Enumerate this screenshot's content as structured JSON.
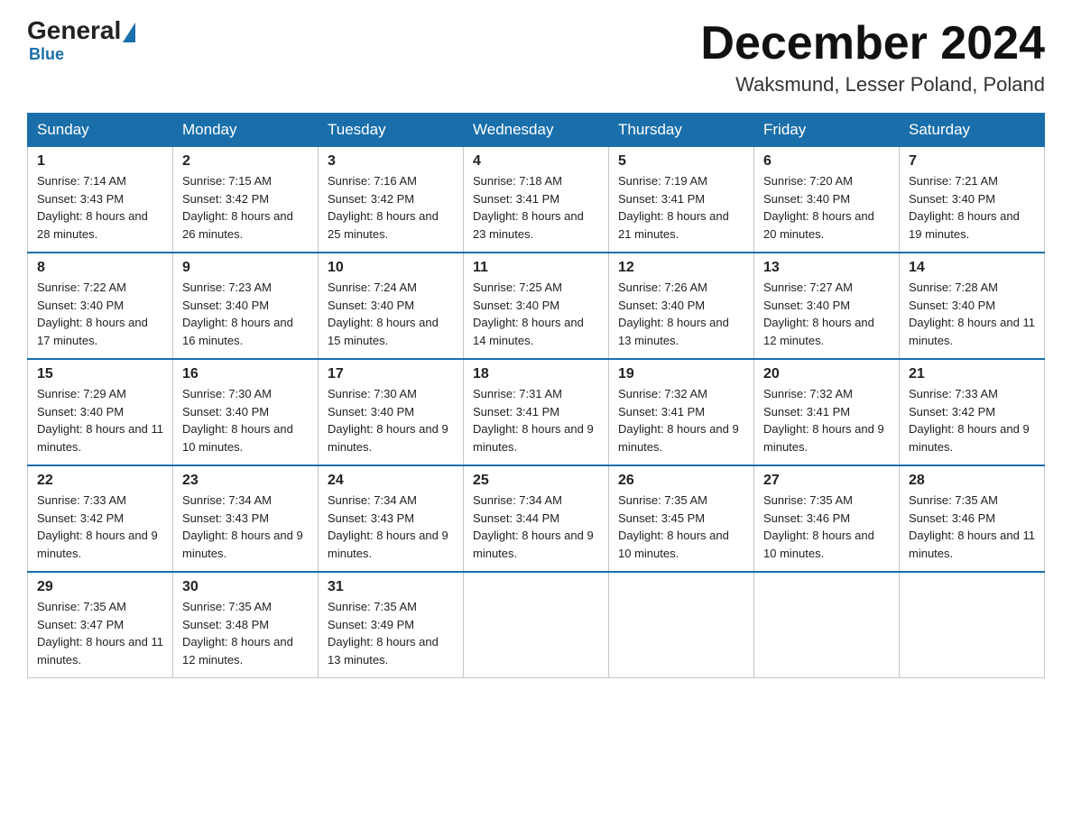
{
  "header": {
    "logo_general": "General",
    "logo_blue": "Blue",
    "month_title": "December 2024",
    "location": "Waksmund, Lesser Poland, Poland"
  },
  "days_of_week": [
    "Sunday",
    "Monday",
    "Tuesday",
    "Wednesday",
    "Thursday",
    "Friday",
    "Saturday"
  ],
  "weeks": [
    [
      {
        "num": "1",
        "sunrise": "7:14 AM",
        "sunset": "3:43 PM",
        "daylight": "8 hours and 28 minutes."
      },
      {
        "num": "2",
        "sunrise": "7:15 AM",
        "sunset": "3:42 PM",
        "daylight": "8 hours and 26 minutes."
      },
      {
        "num": "3",
        "sunrise": "7:16 AM",
        "sunset": "3:42 PM",
        "daylight": "8 hours and 25 minutes."
      },
      {
        "num": "4",
        "sunrise": "7:18 AM",
        "sunset": "3:41 PM",
        "daylight": "8 hours and 23 minutes."
      },
      {
        "num": "5",
        "sunrise": "7:19 AM",
        "sunset": "3:41 PM",
        "daylight": "8 hours and 21 minutes."
      },
      {
        "num": "6",
        "sunrise": "7:20 AM",
        "sunset": "3:40 PM",
        "daylight": "8 hours and 20 minutes."
      },
      {
        "num": "7",
        "sunrise": "7:21 AM",
        "sunset": "3:40 PM",
        "daylight": "8 hours and 19 minutes."
      }
    ],
    [
      {
        "num": "8",
        "sunrise": "7:22 AM",
        "sunset": "3:40 PM",
        "daylight": "8 hours and 17 minutes."
      },
      {
        "num": "9",
        "sunrise": "7:23 AM",
        "sunset": "3:40 PM",
        "daylight": "8 hours and 16 minutes."
      },
      {
        "num": "10",
        "sunrise": "7:24 AM",
        "sunset": "3:40 PM",
        "daylight": "8 hours and 15 minutes."
      },
      {
        "num": "11",
        "sunrise": "7:25 AM",
        "sunset": "3:40 PM",
        "daylight": "8 hours and 14 minutes."
      },
      {
        "num": "12",
        "sunrise": "7:26 AM",
        "sunset": "3:40 PM",
        "daylight": "8 hours and 13 minutes."
      },
      {
        "num": "13",
        "sunrise": "7:27 AM",
        "sunset": "3:40 PM",
        "daylight": "8 hours and 12 minutes."
      },
      {
        "num": "14",
        "sunrise": "7:28 AM",
        "sunset": "3:40 PM",
        "daylight": "8 hours and 11 minutes."
      }
    ],
    [
      {
        "num": "15",
        "sunrise": "7:29 AM",
        "sunset": "3:40 PM",
        "daylight": "8 hours and 11 minutes."
      },
      {
        "num": "16",
        "sunrise": "7:30 AM",
        "sunset": "3:40 PM",
        "daylight": "8 hours and 10 minutes."
      },
      {
        "num": "17",
        "sunrise": "7:30 AM",
        "sunset": "3:40 PM",
        "daylight": "8 hours and 9 minutes."
      },
      {
        "num": "18",
        "sunrise": "7:31 AM",
        "sunset": "3:41 PM",
        "daylight": "8 hours and 9 minutes."
      },
      {
        "num": "19",
        "sunrise": "7:32 AM",
        "sunset": "3:41 PM",
        "daylight": "8 hours and 9 minutes."
      },
      {
        "num": "20",
        "sunrise": "7:32 AM",
        "sunset": "3:41 PM",
        "daylight": "8 hours and 9 minutes."
      },
      {
        "num": "21",
        "sunrise": "7:33 AM",
        "sunset": "3:42 PM",
        "daylight": "8 hours and 9 minutes."
      }
    ],
    [
      {
        "num": "22",
        "sunrise": "7:33 AM",
        "sunset": "3:42 PM",
        "daylight": "8 hours and 9 minutes."
      },
      {
        "num": "23",
        "sunrise": "7:34 AM",
        "sunset": "3:43 PM",
        "daylight": "8 hours and 9 minutes."
      },
      {
        "num": "24",
        "sunrise": "7:34 AM",
        "sunset": "3:43 PM",
        "daylight": "8 hours and 9 minutes."
      },
      {
        "num": "25",
        "sunrise": "7:34 AM",
        "sunset": "3:44 PM",
        "daylight": "8 hours and 9 minutes."
      },
      {
        "num": "26",
        "sunrise": "7:35 AM",
        "sunset": "3:45 PM",
        "daylight": "8 hours and 10 minutes."
      },
      {
        "num": "27",
        "sunrise": "7:35 AM",
        "sunset": "3:46 PM",
        "daylight": "8 hours and 10 minutes."
      },
      {
        "num": "28",
        "sunrise": "7:35 AM",
        "sunset": "3:46 PM",
        "daylight": "8 hours and 11 minutes."
      }
    ],
    [
      {
        "num": "29",
        "sunrise": "7:35 AM",
        "sunset": "3:47 PM",
        "daylight": "8 hours and 11 minutes."
      },
      {
        "num": "30",
        "sunrise": "7:35 AM",
        "sunset": "3:48 PM",
        "daylight": "8 hours and 12 minutes."
      },
      {
        "num": "31",
        "sunrise": "7:35 AM",
        "sunset": "3:49 PM",
        "daylight": "8 hours and 13 minutes."
      },
      null,
      null,
      null,
      null
    ]
  ],
  "labels": {
    "sunrise_prefix": "Sunrise: ",
    "sunset_prefix": "Sunset: ",
    "daylight_prefix": "Daylight: "
  }
}
